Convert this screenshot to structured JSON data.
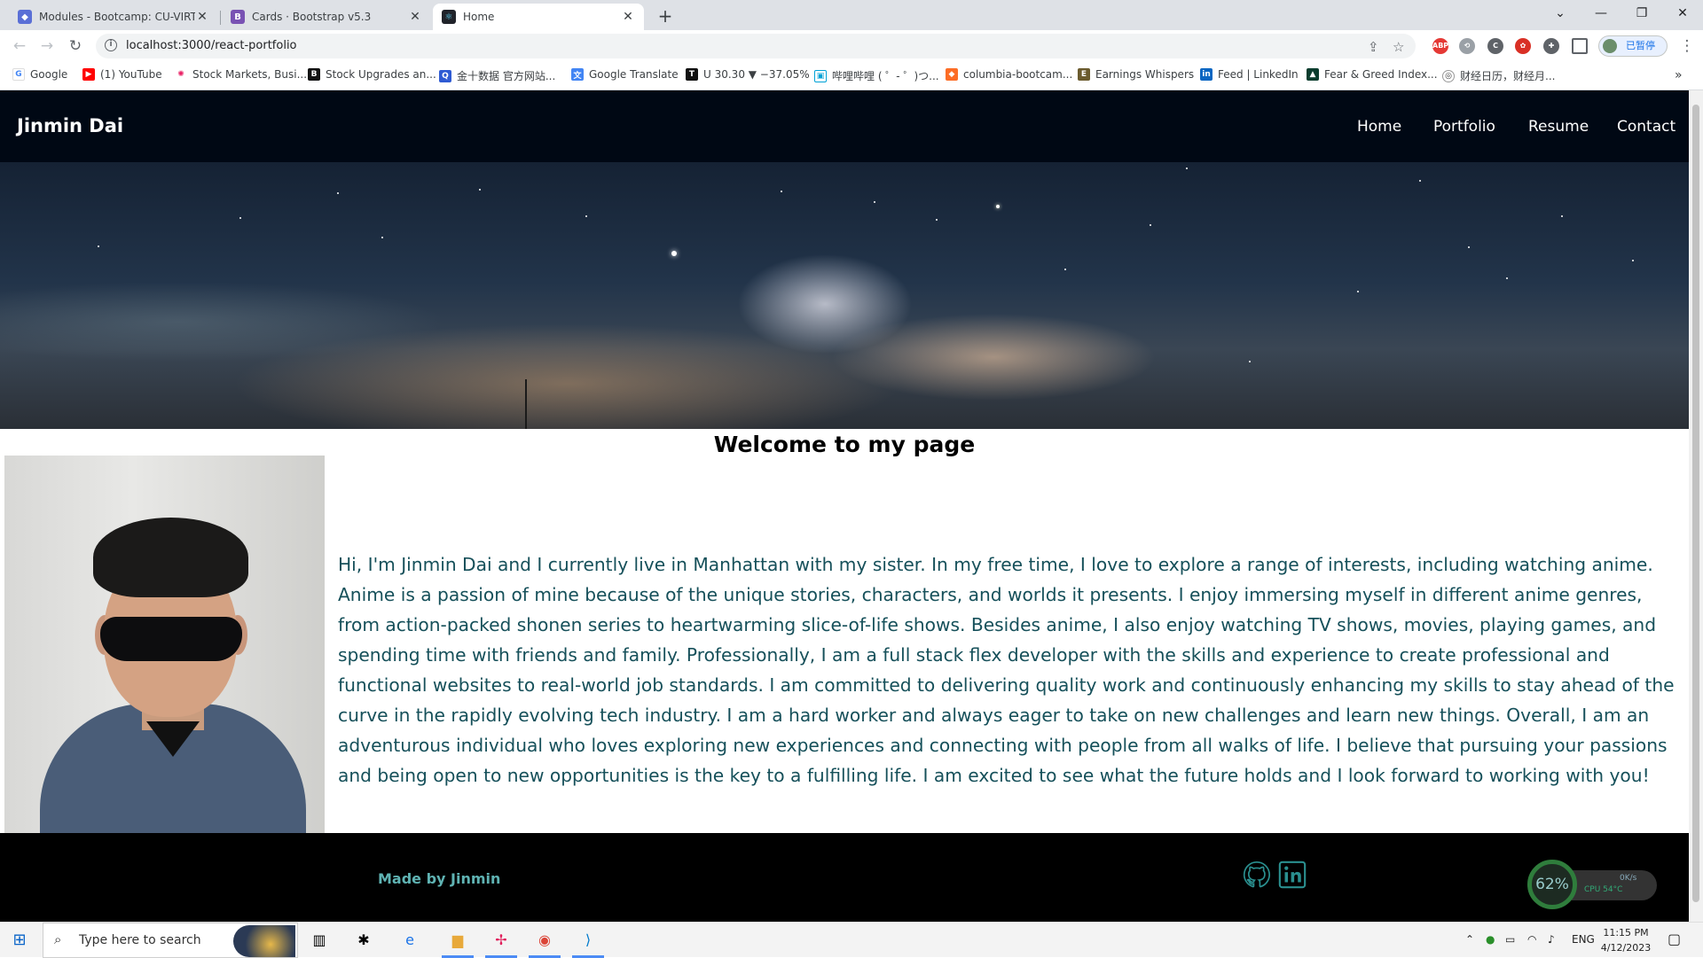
{
  "browser": {
    "tabs": [
      {
        "title": "Modules - Bootcamp: CU-VIRT-F",
        "active": false
      },
      {
        "title": "Cards · Bootstrap v5.3",
        "active": false
      },
      {
        "title": "Home",
        "active": true
      }
    ],
    "new_tab": "+",
    "url": "localhost:3000/react-portfolio",
    "profile_label": "已暂停",
    "bookmarks": [
      "Google",
      "(1) YouTube",
      "Stock Markets, Busi...",
      "Stock Upgrades an...",
      "金十数据 官方网站...",
      "Google Translate",
      "U 30.30 ▼ −37.05%",
      "哔哩哔哩 ( ゜- ゜)つ...",
      "columbia-bootcam...",
      "Earnings Whispers",
      "Feed | LinkedIn",
      "Fear & Greed Index...",
      "财经日历，财经月..."
    ]
  },
  "site": {
    "brand": "Jinmin Dai",
    "nav": [
      "Home",
      "Portfolio",
      "Resume",
      "Contact"
    ],
    "welcome": "Welcome to my page",
    "bio": "Hi, I'm Jinmin Dai and I currently live in Manhattan with my sister. In my free time, I love to explore a range of interests, including watching anime. Anime is a passion of mine because of the unique stories, characters, and worlds it presents. I enjoy immersing myself in different anime genres, from action-packed shonen series to heartwarming slice-of-life shows. Besides anime, I also enjoy watching TV shows, movies, playing games, and spending time with friends and family. Professionally, I am a full stack flex developer with the skills and experience to create professional and functional websites to real-world job standards. I am committed to delivering quality work and continuously enhancing my skills to stay ahead of the curve in the rapidly evolving tech industry. I am a hard worker and always eager to take on new challenges and learn new things. Overall, I am an adventurous individual who loves exploring new experiences and connecting with people from all walks of life. I believe that pursuing your passions and being open to new opportunities is the key to a fulfilling life. I am excited to see what the future holds and I look forward to working with you!",
    "footer_text": "Made by Jinmin",
    "social_icons": [
      "github-icon",
      "linkedin-icon"
    ],
    "accent_color": "#5fb3b3"
  },
  "widget": {
    "percent": "62%",
    "speed": "0K/s",
    "cpu": "CPU 54°C"
  },
  "taskbar": {
    "search_placeholder": "Type here to search",
    "language": "ENG",
    "time": "11:15 PM",
    "date": "4/12/2023"
  }
}
